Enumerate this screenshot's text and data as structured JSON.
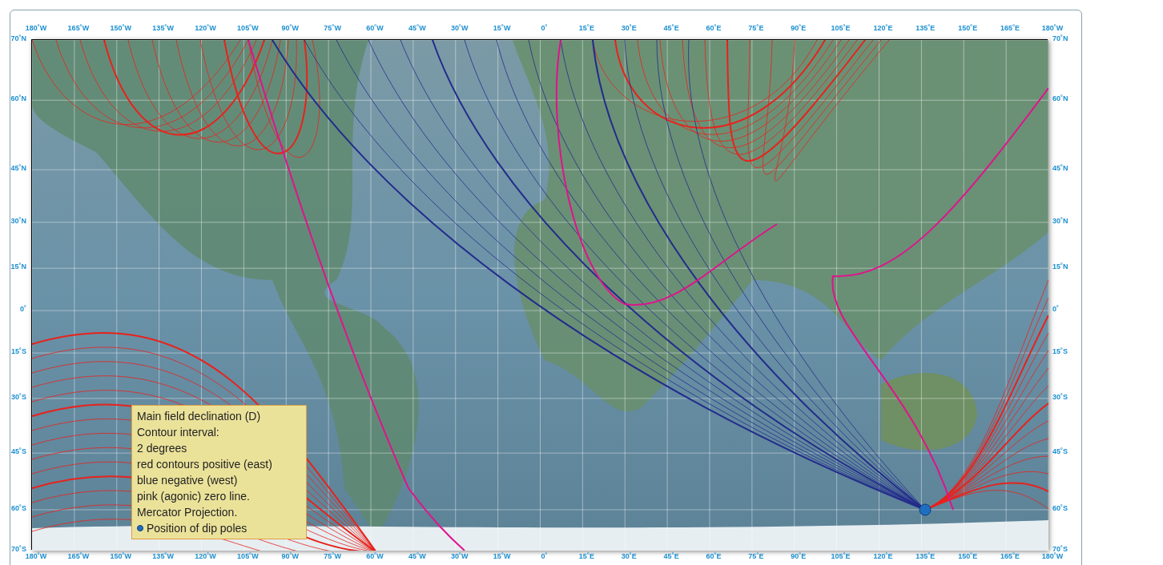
{
  "map": {
    "longitude_labels_top": [
      "180˚W",
      "165˚W",
      "150˚W",
      "135˚W",
      "120˚W",
      "105˚W",
      "90˚W",
      "75˚W",
      "60˚W",
      "45˚W",
      "30˚W",
      "15˚W",
      "0˚",
      "15˚E",
      "30˚E",
      "45˚E",
      "60˚E",
      "75˚E",
      "90˚E",
      "105˚E",
      "120˚E",
      "135˚E",
      "150˚E",
      "165˚E",
      "180˚W"
    ],
    "latitude_labels_left": [
      "70˚N",
      "60˚N",
      "45˚N",
      "30˚N",
      "15˚N",
      "0˚",
      "15˚S",
      "30˚S",
      "45˚S",
      "60˚S",
      "70˚S"
    ],
    "latitude_labels_right": [
      "70˚N",
      "60˚N",
      "45˚N",
      "30˚N",
      "15˚N",
      "0˚",
      "15˚S",
      "30˚S",
      "45˚S",
      "60˚S",
      "70˚S"
    ],
    "longitude_labels_bottom": [
      "180˚W",
      "165˚W",
      "150˚W",
      "135˚W",
      "120˚W",
      "105˚W",
      "90˚W",
      "75˚W",
      "60˚W",
      "45˚W",
      "30˚W",
      "15˚W",
      "0˚",
      "15˚E",
      "30˚E",
      "45˚E",
      "60˚E",
      "75˚E",
      "90˚E",
      "105˚E",
      "120˚E",
      "135˚E",
      "150˚E",
      "165˚E",
      "180˚W"
    ],
    "legend": {
      "lines": [
        "Main field declination (D)",
        "Contour interval:",
        "2 degrees",
        "red contours positive (east)",
        "blue negative (west)",
        "pink (agonic) zero line.",
        "Mercator Projection."
      ],
      "pole_note": "Position of dip poles"
    }
  }
}
